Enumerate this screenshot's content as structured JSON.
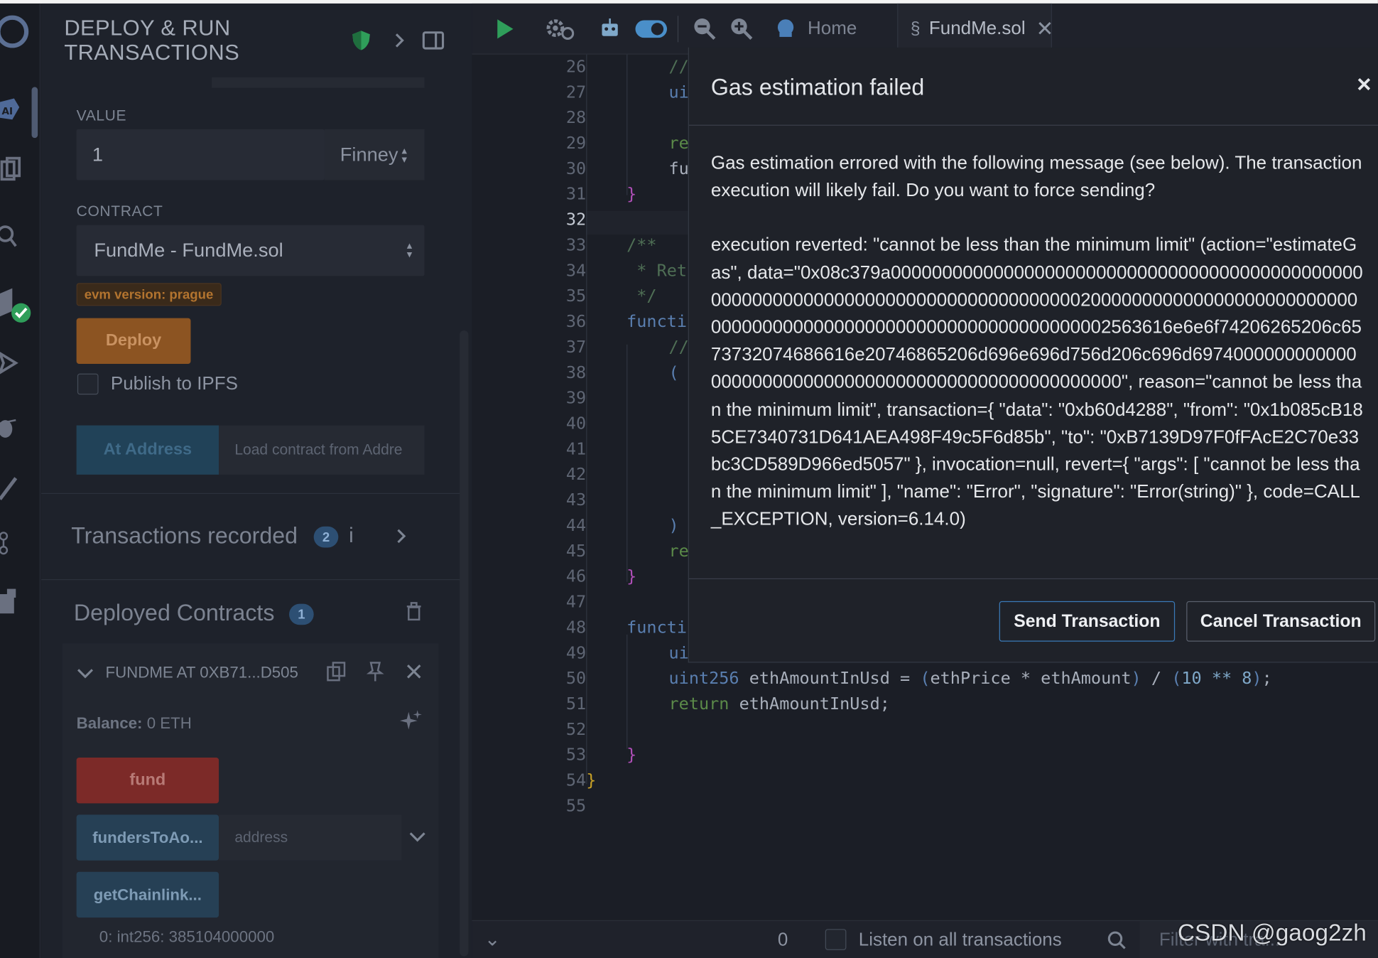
{
  "panel": {
    "title_line1": "DEPLOY & RUN",
    "title_line2": "TRANSACTIONS",
    "value_label": "VALUE",
    "value_input": "1",
    "value_unit": "Finney",
    "contract_label": "CONTRACT",
    "contract_select": "FundMe - FundMe.sol",
    "evm_badge": "evm version: prague",
    "deploy_button": "Deploy",
    "publish_ipfs": "Publish to IPFS",
    "at_address_button": "At Address",
    "load_contract_placeholder": "Load contract from Addre",
    "transactions_recorded": "Transactions recorded",
    "transactions_count": "2",
    "deployed_contracts": "Deployed Contracts",
    "deployed_count": "1",
    "contract_instance": "FUNDME AT 0XB71...D505",
    "balance_label": "Balance:",
    "balance_value": "0 ETH",
    "fund_button": "fund",
    "funders_button": "fundersToAo...",
    "funders_placeholder": "address",
    "getchainlink_button": "getChainlink...",
    "output_line": "0: int256: 385104000000"
  },
  "editor": {
    "tab_home": "Home",
    "tab_file": "FundMe.sol",
    "line_numbers": [
      "26",
      "27",
      "28",
      "29",
      "30",
      "31",
      "32",
      "33",
      "34",
      "35",
      "36",
      "37",
      "38",
      "39",
      "40",
      "41",
      "42",
      "43",
      "44",
      "45",
      "46",
      "47",
      "48",
      "49",
      "50",
      "51",
      "52",
      "53",
      "54",
      "55"
    ],
    "code_l26": "//",
    "code_l27": "ui",
    "code_l29": "re",
    "code_l30": "fu",
    "code_l31": "}",
    "code_l33": "/**",
    "code_l34": " * Ret",
    "code_l35": " */",
    "code_l36": "functi",
    "code_l37": "//",
    "code_l38": "(",
    "code_l44": ")",
    "code_l45": "re",
    "code_l46": "}",
    "code_l48": "functi",
    "code_l49": "ui",
    "code_l50_a": "uint256",
    "code_l50_b": " ethAmountInUsd = ",
    "code_l50_c": "(",
    "code_l50_d": "ethPrice * ethAmount",
    "code_l50_e": ")",
    "code_l50_f": " / ",
    "code_l50_g": "(",
    "code_l50_h": "10 ** 8",
    "code_l50_i": ")",
    "code_l50_j": ";",
    "code_l51_a": "return",
    "code_l51_b": " ethAmountInUsd;",
    "code_l53": "}",
    "code_l54": "}",
    "bottom_count": "0",
    "listen_label": "Listen on all transactions",
    "filter_placeholder": "Filter with tra..."
  },
  "modal": {
    "title": "Gas estimation failed",
    "close": "×",
    "message": "Gas estimation errored with the following message (see below). The transaction execution will likely fail. Do you want to force sending?",
    "error_detail": "execution reverted: \"cannot be less than the minimum limit\" (action=\"estimateGas\", data=\"0x08c379a0000000000000000000000000000000000000000000000000000000000000000000000000000000000200000000000000000000000000000000000000000000000000000000000000002563616e6e6f74206265206c6573732074686616e20746865206d696e696d756d206c696d69740000000000000000000000000000000000000000000000000000\", reason=\"cannot be less than the minimum limit\", transaction={ \"data\": \"0xb60d4288\", \"from\": \"0x1b085cB185CE7340731D641AEA498F49c5F6d85b\", \"to\": \"0xB7139D97F0fFAcE2C70e33bc3CD589D966ed5057\" }, invocation=null, revert={ \"args\": [ \"cannot be less than the minimum limit\" ], \"name\": \"Error\", \"signature\": \"Error(string)\" }, code=CALL_EXCEPTION, version=6.14.0)",
    "send_button": "Send Transaction",
    "cancel_button": "Cancel Transaction"
  },
  "watermark": "CSDN @gaog2zh",
  "colors": {
    "deploy": "#8c5422",
    "fund": "#7c2a28",
    "at_address": "#214258",
    "send_border": "#3a7ab8"
  }
}
